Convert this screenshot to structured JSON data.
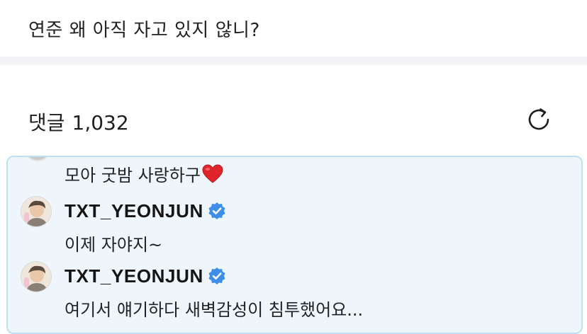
{
  "post": {
    "title": "연준 왜 아직 자고 있지 않니?"
  },
  "comments_header": {
    "label": "댓글",
    "count": "1,032",
    "refresh_icon": "refresh-icon"
  },
  "thread": {
    "continued_text": "모아 굿밤 사랑하구",
    "continued_emoji": "❤️",
    "replies": [
      {
        "author": "TXT_YEONJUN",
        "verified": true,
        "text": "이제 자야지~"
      },
      {
        "author": "TXT_YEONJUN",
        "verified": true,
        "text": "여기서 얘기하다 새벽감성이 침투했어요..."
      }
    ]
  },
  "colors": {
    "thread_background": "#eef6fb",
    "thread_border": "#bfe0ee",
    "verified_badge": "#3d8ee8",
    "separator": "#f4f4f6"
  }
}
